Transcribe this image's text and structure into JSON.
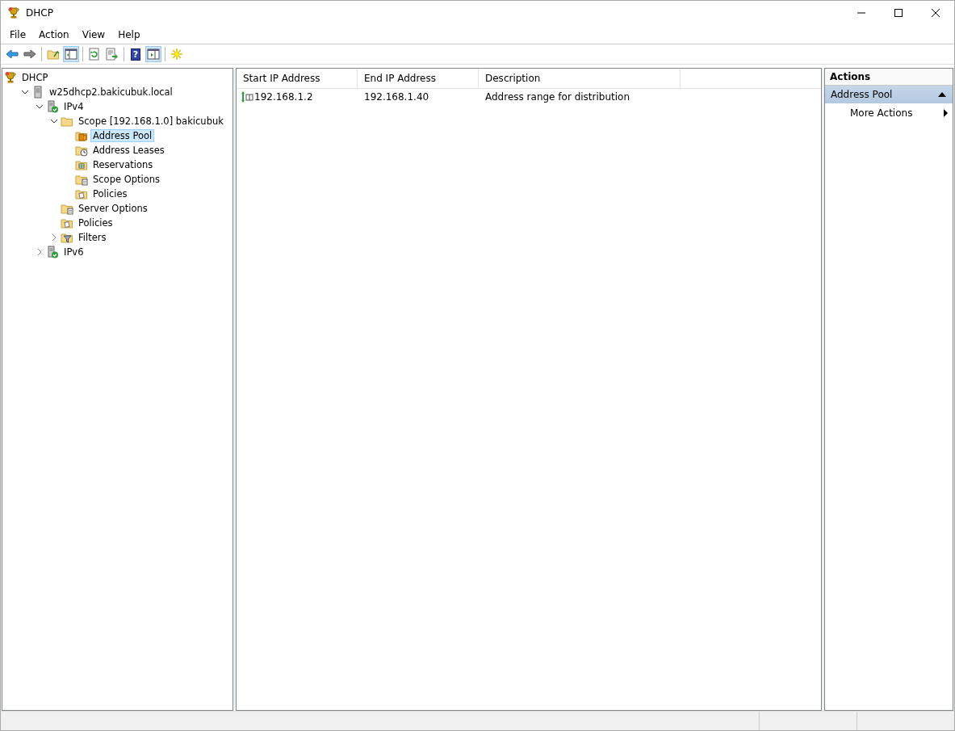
{
  "window": {
    "title": "DHCP"
  },
  "menu": [
    "File",
    "Action",
    "View",
    "Help"
  ],
  "toolbar": [
    {
      "kind": "back",
      "pressed": false
    },
    {
      "kind": "forward",
      "pressed": false
    },
    {
      "kind": "separator"
    },
    {
      "kind": "up",
      "pressed": false
    },
    {
      "kind": "tree",
      "pressed": true
    },
    {
      "kind": "separator"
    },
    {
      "kind": "refresh",
      "pressed": false
    },
    {
      "kind": "export",
      "pressed": false
    },
    {
      "kind": "separator"
    },
    {
      "kind": "help",
      "glyph": "?",
      "pressed": false
    },
    {
      "kind": "actions",
      "pressed": true
    },
    {
      "kind": "separator"
    },
    {
      "kind": "new",
      "pressed": false
    }
  ],
  "tree": [
    {
      "label": "DHCP",
      "kind": "trophy",
      "selected": false,
      "children": [
        {
          "label": "w25dhcp2.bakicubuk.local",
          "kind": "server",
          "expanded": true,
          "selected": false,
          "children": [
            {
              "label": "IPv4",
              "kind": "server-ok",
              "expanded": true,
              "selected": false,
              "children": [
                {
                  "label": "Scope [192.168.1.0] bakicubuk",
                  "kind": "folder",
                  "expanded": true,
                  "selected": false,
                  "children": [
                    {
                      "label": "Address Pool",
                      "kind": "pool",
                      "selected": true
                    },
                    {
                      "label": "Address Leases",
                      "kind": "leases",
                      "selected": false
                    },
                    {
                      "label": "Reservations",
                      "kind": "grid",
                      "selected": false
                    },
                    {
                      "label": "Scope Options",
                      "kind": "options",
                      "selected": false
                    },
                    {
                      "label": "Policies",
                      "kind": "policy",
                      "selected": false
                    }
                  ]
                },
                {
                  "label": "Server Options",
                  "kind": "options",
                  "selected": false
                },
                {
                  "label": "Policies",
                  "kind": "policy",
                  "selected": false
                },
                {
                  "label": "Filters",
                  "kind": "filter",
                  "expanded": false,
                  "selected": false
                }
              ]
            },
            {
              "label": "IPv6",
              "kind": "server-ok",
              "expanded": false,
              "selected": false
            }
          ]
        }
      ]
    }
  ],
  "list": {
    "columns": [
      "Start IP Address",
      "End IP Address",
      "Description"
    ],
    "rows": [
      {
        "cells": [
          "192.168.1.2",
          "192.168.1.40",
          "Address range for distribution"
        ]
      }
    ]
  },
  "actions": {
    "title": "Actions",
    "sections": [
      {
        "title": "Address Pool",
        "expanded": true,
        "items": [
          {
            "label": "More Actions",
            "submenu": true
          }
        ]
      }
    ]
  }
}
